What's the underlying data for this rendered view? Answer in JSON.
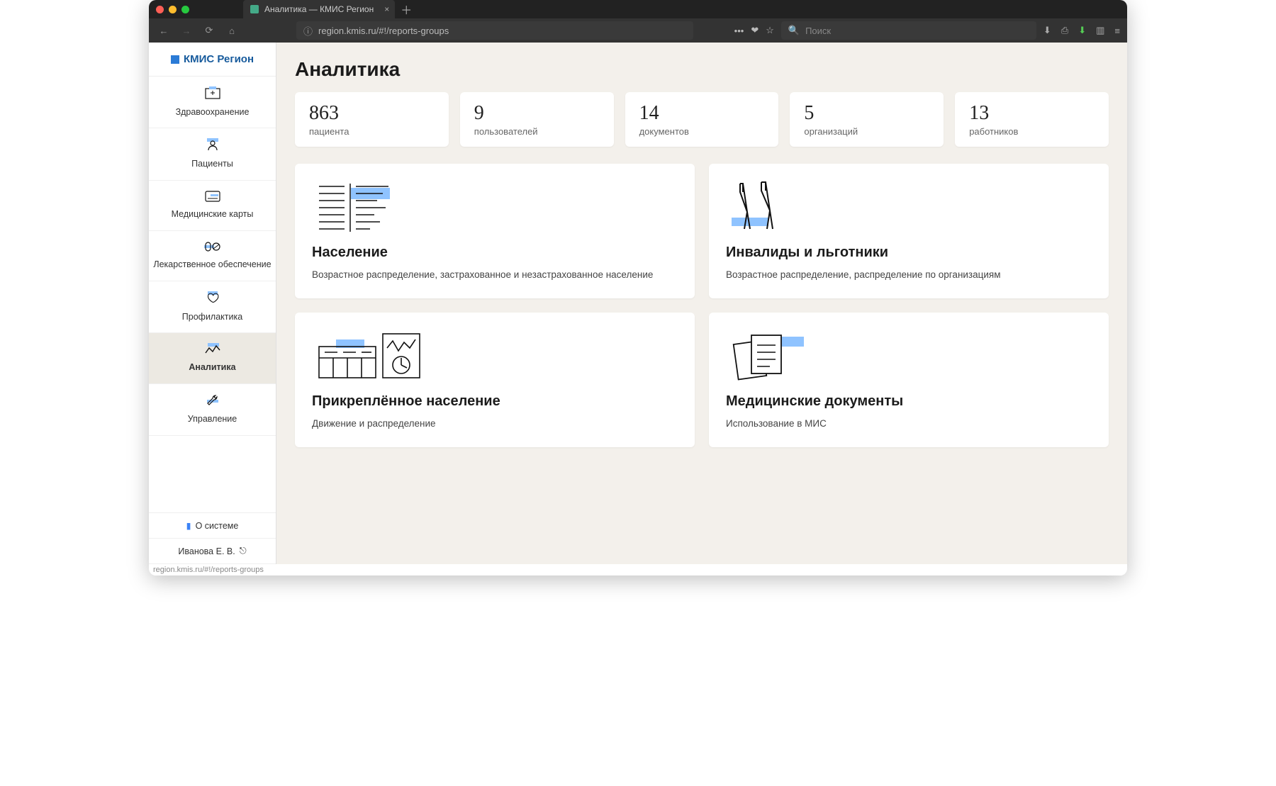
{
  "browser": {
    "tab_title": "Аналитика — КМИС Регион",
    "url": "region.kmis.ru/#!/reports-groups",
    "search_placeholder": "Поиск",
    "status_text": "region.kmis.ru/#!/reports-groups"
  },
  "brand": {
    "name": "КМИС Регион"
  },
  "sidebar": {
    "items": [
      {
        "label": "Здравоохранение"
      },
      {
        "label": "Пациенты"
      },
      {
        "label": "Медицинские карты"
      },
      {
        "label": "Лекарственное обеспечение"
      },
      {
        "label": "Профилактика"
      },
      {
        "label": "Аналитика"
      },
      {
        "label": "Управление"
      }
    ],
    "footer": {
      "about": "О системе",
      "user": "Иванова Е. В."
    }
  },
  "page": {
    "title": "Аналитика",
    "stats": [
      {
        "value": "863",
        "label": "пациента"
      },
      {
        "value": "9",
        "label": "пользователей"
      },
      {
        "value": "14",
        "label": "документов"
      },
      {
        "value": "5",
        "label": "организаций"
      },
      {
        "value": "13",
        "label": "работников"
      }
    ],
    "cards": [
      {
        "title": "Население",
        "subtitle": "Возрастное распределение, застрахованное и незастрахованное население"
      },
      {
        "title": "Инвалиды и льготники",
        "subtitle": "Возрастное распределение, распределение по организациям"
      },
      {
        "title": "Прикреплённое население",
        "subtitle": "Движение и распределение"
      },
      {
        "title": "Медицинские документы",
        "subtitle": "Использование в МИС"
      }
    ]
  }
}
